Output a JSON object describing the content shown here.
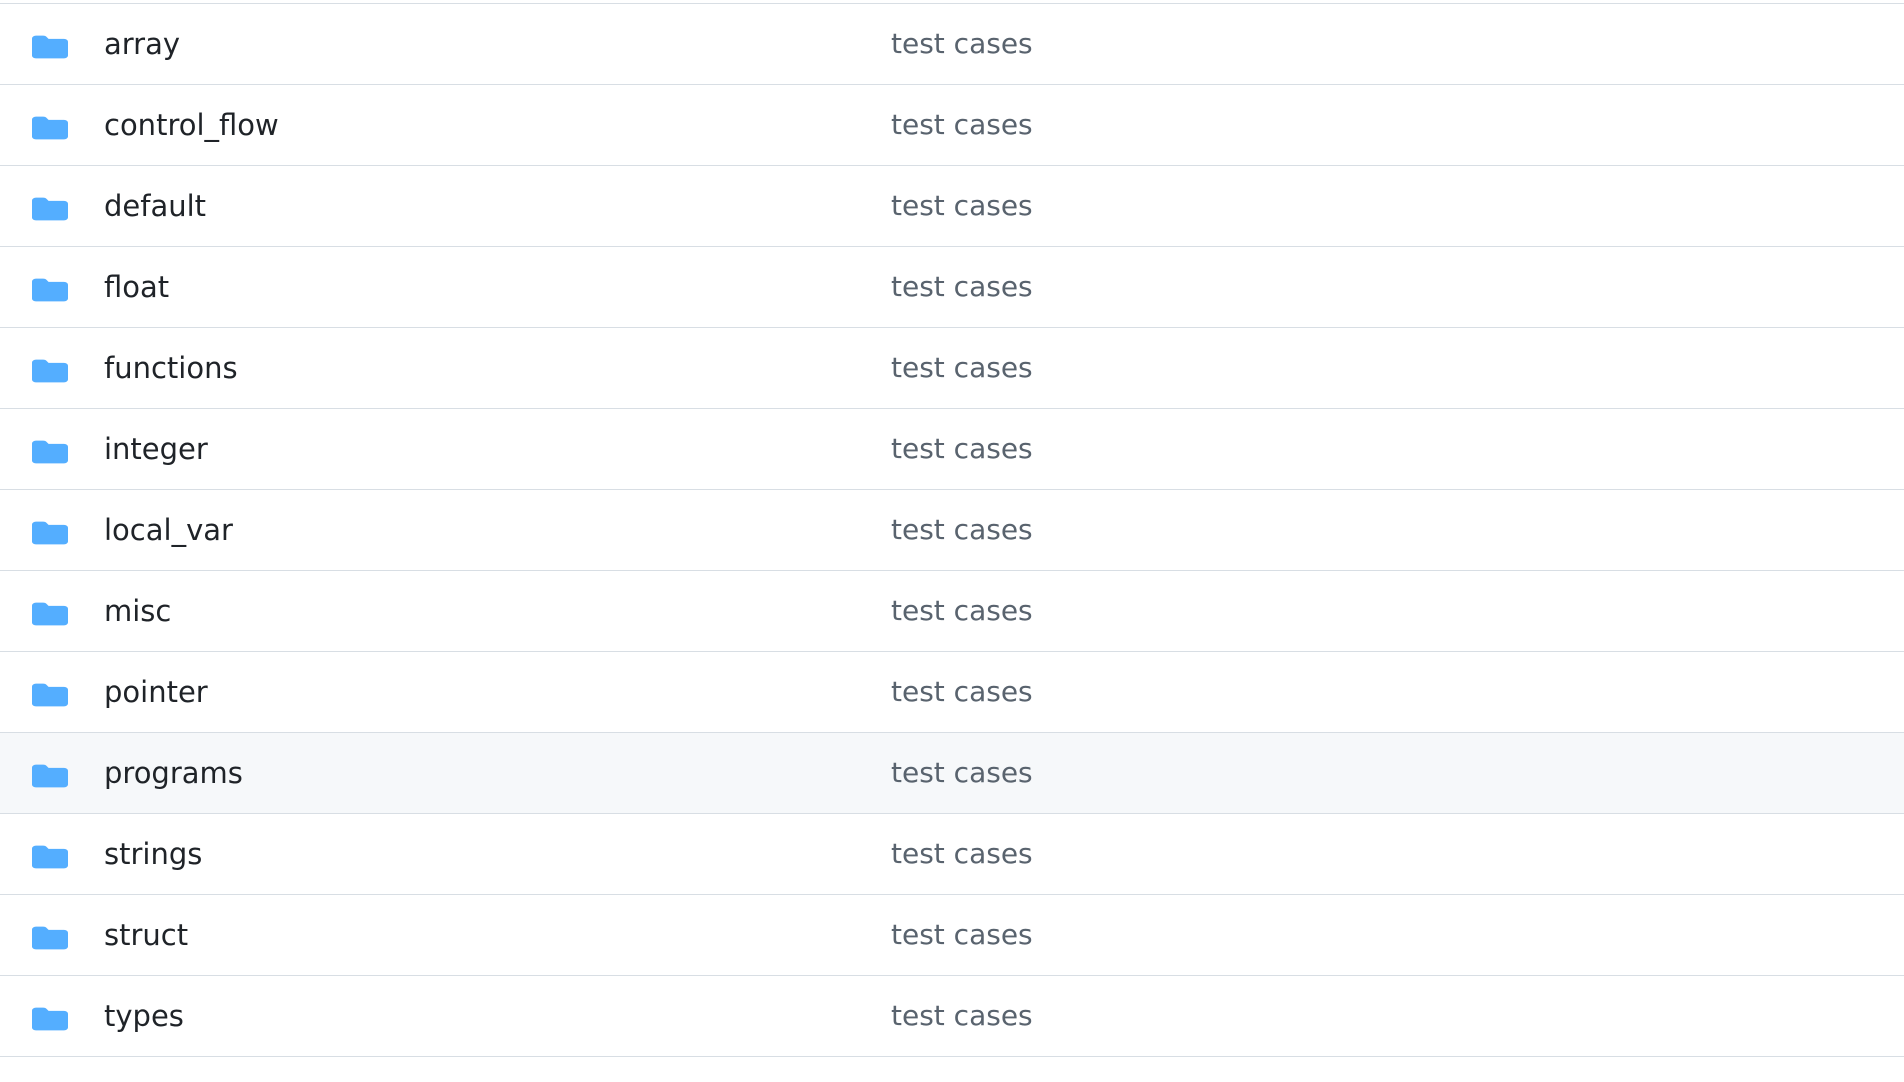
{
  "colors": {
    "folder_icon": "#54aeff",
    "folder_tab": "#54aeff",
    "row_hover_background": "#f6f8fa",
    "divider": "#d8dee4",
    "name_text": "#1f2328",
    "message_text": "#59636e"
  },
  "icons": {
    "folder": "folder-icon"
  },
  "hovered_row_index": 9,
  "files": [
    {
      "name": "array",
      "message": "test cases"
    },
    {
      "name": "control_flow",
      "message": "test cases"
    },
    {
      "name": "default",
      "message": "test cases"
    },
    {
      "name": "float",
      "message": "test cases"
    },
    {
      "name": "functions",
      "message": "test cases"
    },
    {
      "name": "integer",
      "message": "test cases"
    },
    {
      "name": "local_var",
      "message": "test cases"
    },
    {
      "name": "misc",
      "message": "test cases"
    },
    {
      "name": "pointer",
      "message": "test cases"
    },
    {
      "name": "programs",
      "message": "test cases"
    },
    {
      "name": "strings",
      "message": "test cases"
    },
    {
      "name": "struct",
      "message": "test cases"
    },
    {
      "name": "types",
      "message": "test cases"
    }
  ]
}
